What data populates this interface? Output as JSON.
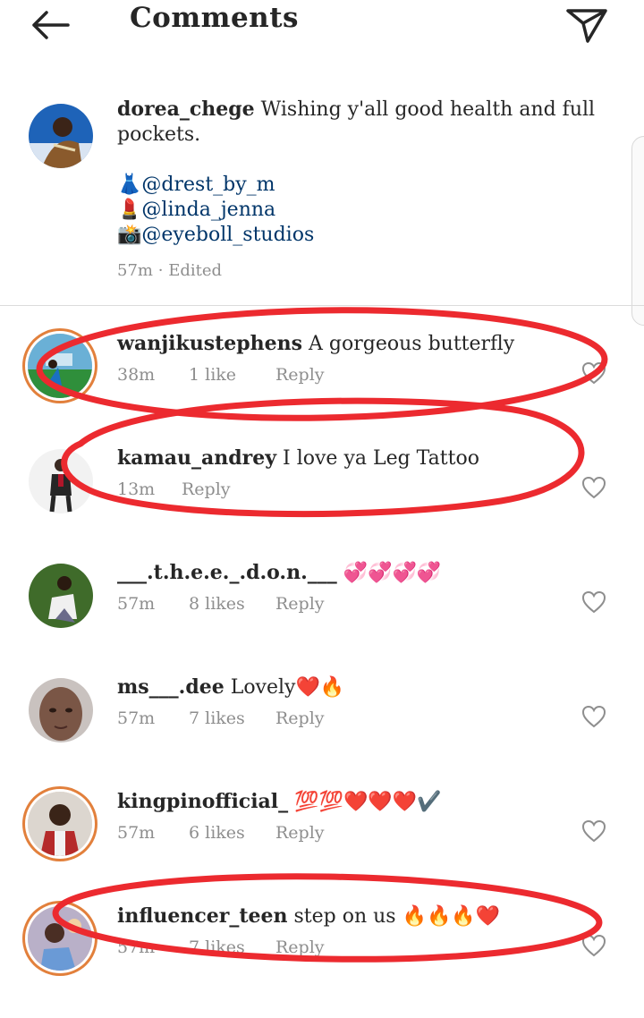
{
  "header": {
    "title": "Comments",
    "back_icon": "back-arrow-icon",
    "send_icon": "send-icon"
  },
  "post": {
    "username": "dorea_chege",
    "text": "Wishing y'all good health and full pockets.",
    "credits": [
      {
        "emoji": "👗",
        "handle": "@drest_by_m"
      },
      {
        "emoji": "💄",
        "handle": "@linda_jenna"
      },
      {
        "emoji": "📸",
        "handle": "@eyeboll_studios"
      }
    ],
    "time": "57m",
    "separator": "·",
    "edited": "Edited"
  },
  "comments": [
    {
      "username": "wanjikustephens",
      "text": "A  gorgeous  butterfly",
      "time": "38m",
      "likes": "1 like",
      "reply": "Reply"
    },
    {
      "username": "kamau_andrey",
      "text": "I love ya Leg Tattoo",
      "time": "13m",
      "likes": "",
      "reply": "Reply"
    },
    {
      "username": "___.t.h.e.e._.d.o.n.___",
      "text": "💞💞💞💞",
      "time": "57m",
      "likes": "8 likes",
      "reply": "Reply"
    },
    {
      "username": "ms___.dee",
      "text": "Lovely❤️🔥",
      "time": "57m",
      "likes": "7 likes",
      "reply": "Reply"
    },
    {
      "username": "kingpinofficial_",
      "text": "💯💯❤️❤️❤️✔️",
      "time": "57m",
      "likes": "6 likes",
      "reply": "Reply"
    },
    {
      "username": "influencer_teen",
      "text": "step on us 🔥🔥🔥❤️",
      "time": "57m",
      "likes": "7 likes",
      "reply": "Reply"
    }
  ],
  "colors": {
    "annotation": "#ec2a2f",
    "mention": "#003569",
    "meta": "#8e8e8e",
    "story_ring": "#e2803c"
  }
}
